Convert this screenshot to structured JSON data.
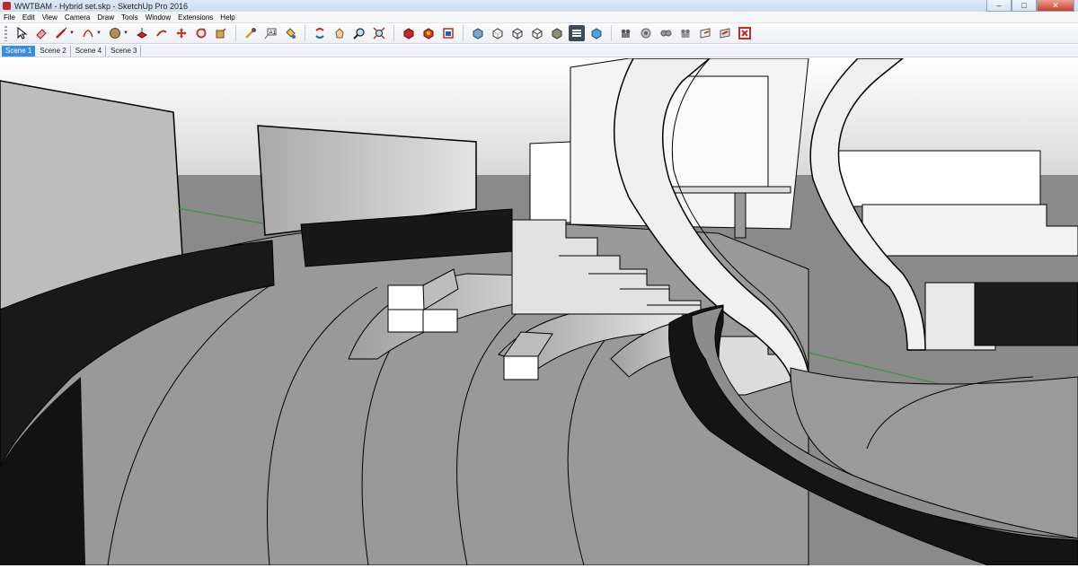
{
  "window": {
    "title": "WWTBAM - Hybrid set.skp - SketchUp Pro 2016"
  },
  "menu": [
    "File",
    "Edit",
    "View",
    "Camera",
    "Draw",
    "Tools",
    "Window",
    "Extensions",
    "Help"
  ],
  "toolbar": {
    "tools": [
      "select-tool-icon",
      "eraser-tool-icon",
      "line-tool-icon",
      "arc-tool-icon",
      "shape-tool-icon",
      "push-pull-tool-icon",
      "follow-me-icon",
      "move-tool-icon",
      "rotate-tool-icon",
      "scale-tool-icon",
      "tape-measure-icon",
      "text-tool-icon",
      "paint-bucket-icon",
      "orbit-icon",
      "pan-icon",
      "zoom-icon",
      "zoom-extents-icon",
      "3d-warehouse-icon",
      "extension-warehouse-icon",
      "layout-icon",
      "xray-style-icon",
      "back-edges-style-icon",
      "wireframe-style-icon",
      "hidden-line-style-icon",
      "shaded-style-icon",
      "shaded-textures-icon",
      "add-camera-icon",
      "look-around-icon",
      "walk-icon",
      "position-camera-icon",
      "section-plane-icon",
      "display-section-icon",
      "sketchup-exit-icon"
    ],
    "active_tool": "shaded-style-icon"
  },
  "scenes": {
    "tabs": [
      "Scene 1",
      "Scene 2",
      "Scene 4",
      "Scene 3"
    ],
    "active": "Scene 1"
  },
  "colors": {
    "sky": "#d9d9d9",
    "ground": "#8a8a8a",
    "floor": "#999999",
    "wall_dark": "#1b1b1b",
    "white": "#ffffff",
    "accent_tab": "#3a8ee6"
  }
}
